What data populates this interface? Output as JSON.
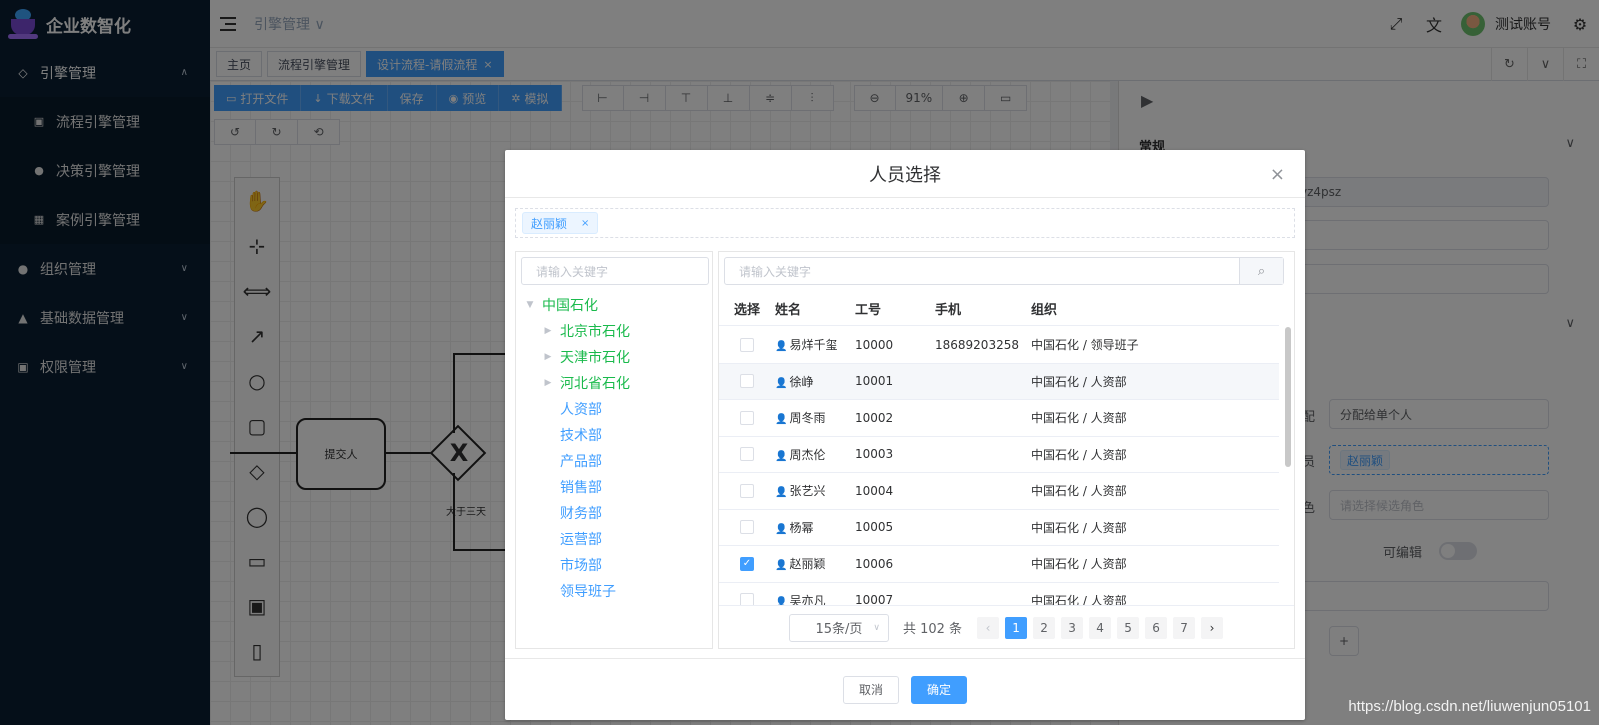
{
  "app": {
    "title": "企业数智化"
  },
  "sidebar": {
    "items": [
      {
        "label": "引擎管理",
        "icon": "diamond-icon",
        "open": true,
        "children": [
          {
            "label": "流程引擎管理",
            "icon": "calendar-icon"
          },
          {
            "label": "决策引擎管理",
            "icon": "bitcoin-icon"
          },
          {
            "label": "案例引擎管理",
            "icon": "grid-icon"
          }
        ]
      },
      {
        "label": "组织管理",
        "icon": "apple-icon"
      },
      {
        "label": "基础数据管理",
        "icon": "android-icon"
      },
      {
        "label": "权限管理",
        "icon": "calendar-check-icon"
      }
    ]
  },
  "header": {
    "breadcrumb": "引擎管理 ∨",
    "username": "测试账号"
  },
  "tags": [
    {
      "label": "主页"
    },
    {
      "label": "流程引擎管理"
    },
    {
      "label": "设计流程-请假流程",
      "active": true,
      "close": "×"
    }
  ],
  "designer": {
    "toolbar": {
      "open_file": "打开文件",
      "download_file": "下载文件",
      "save": "保存",
      "preview": "预览",
      "simulate": "模拟",
      "zoom": "91%"
    },
    "task_label": "提交人",
    "gateway_symbol": "X",
    "flow_label": "大于三天"
  },
  "props": {
    "section_title": "常规",
    "id_value": "vz4psz",
    "assign_label": "分配",
    "assign_value": "分配给单个人",
    "person_label": "人员",
    "person_chip": "赵丽颖",
    "role_label": "角色",
    "role_placeholder": "请选择候选角色",
    "editable_label": "可编辑",
    "plus": "+"
  },
  "modal": {
    "title": "人员选择",
    "close": "×",
    "selected": [
      {
        "label": "赵丽颖",
        "close": "×"
      }
    ],
    "tree_search_placeholder": "请输入关键字",
    "table_search_placeholder": "请输入关键字",
    "tree": [
      {
        "label": "中国石化",
        "level": 0,
        "expanded": true
      },
      {
        "label": "北京市石化",
        "level": 1,
        "has_children": true
      },
      {
        "label": "天津市石化",
        "level": 1,
        "has_children": true
      },
      {
        "label": "河北省石化",
        "level": 1,
        "has_children": true
      },
      {
        "label": "人资部",
        "level": 1
      },
      {
        "label": "技术部",
        "level": 1
      },
      {
        "label": "产品部",
        "level": 1
      },
      {
        "label": "销售部",
        "level": 1
      },
      {
        "label": "财务部",
        "level": 1
      },
      {
        "label": "运营部",
        "level": 1
      },
      {
        "label": "市场部",
        "level": 1
      },
      {
        "label": "领导班子",
        "level": 1
      }
    ],
    "columns": [
      "选择",
      "姓名",
      "工号",
      "手机",
      "组织"
    ],
    "rows": [
      {
        "name": "易烊千玺",
        "no": "10000",
        "phone": "18689203258",
        "org": "中国石化 / 领导班子",
        "checked": false
      },
      {
        "name": "徐峥",
        "no": "10001",
        "phone": "",
        "org": "中国石化 / 人资部",
        "checked": false
      },
      {
        "name": "周冬雨",
        "no": "10002",
        "phone": "",
        "org": "中国石化 / 人资部",
        "checked": false
      },
      {
        "name": "周杰伦",
        "no": "10003",
        "phone": "",
        "org": "中国石化 / 人资部",
        "checked": false
      },
      {
        "name": "张艺兴",
        "no": "10004",
        "phone": "",
        "org": "中国石化 / 人资部",
        "checked": false
      },
      {
        "name": "杨幂",
        "no": "10005",
        "phone": "",
        "org": "中国石化 / 人资部",
        "checked": false
      },
      {
        "name": "赵丽颖",
        "no": "10006",
        "phone": "",
        "org": "中国石化 / 人资部",
        "checked": true
      },
      {
        "name": "吴亦凡",
        "no": "10007",
        "phone": "",
        "org": "中国石化 / 人资部",
        "checked": false
      }
    ],
    "pager": {
      "page_size": "15条/页",
      "total": "共 102 条",
      "pages": [
        "1",
        "2",
        "3",
        "4",
        "5",
        "6",
        "7"
      ],
      "current": "1",
      "prev": "‹",
      "next": "›"
    },
    "cancel": "取消",
    "ok": "确定"
  },
  "watermark": "https://blog.csdn.net/liuwenjun05101",
  "colors": {
    "primary": "#409eff",
    "sidebar": "#0a1f33",
    "tree_green": "#1aba4c"
  }
}
